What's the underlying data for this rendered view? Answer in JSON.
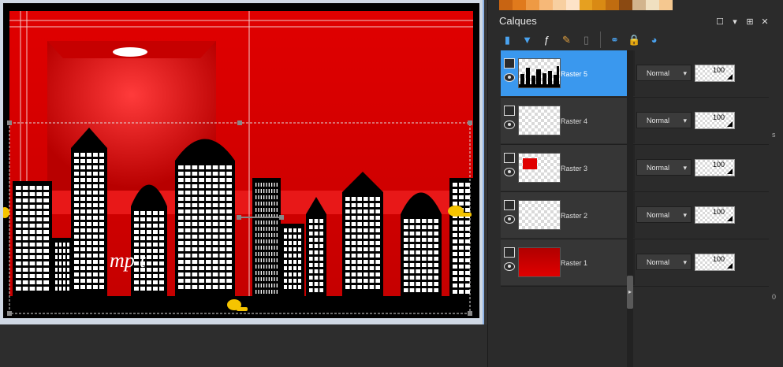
{
  "panel": {
    "title": "Calques",
    "title_buttons": [
      "☐",
      "▾",
      "⊞",
      "✕"
    ],
    "palette_colors": [
      "#c86412",
      "#e07a1c",
      "#ee9a44",
      "#f6b878",
      "#f7cfa0",
      "#fde3c8",
      "#e6a020",
      "#d98a14",
      "#c06c10",
      "#8b4a12",
      "#d2b48c",
      "#f0e0c0",
      "#f5c890"
    ],
    "toolbar_icons": [
      {
        "name": "new-raster-layer-icon",
        "glyph": "▮",
        "color": "#4aa3f0"
      },
      {
        "name": "new-vector-layer-icon",
        "glyph": "▼",
        "color": "#4aa3f0"
      },
      {
        "name": "fx-effects-icon",
        "glyph": "ƒ",
        "color": "#ffffff"
      },
      {
        "name": "paint-brush-icon",
        "glyph": "✎",
        "color": "#e0a040"
      },
      {
        "name": "mask-icon",
        "glyph": "▯",
        "color": "#777777"
      },
      {
        "name": "link-icon",
        "glyph": "⚭",
        "color": "#4aa3f0"
      },
      {
        "name": "lock-icon",
        "glyph": "🔒",
        "color": "#e0b020"
      },
      {
        "name": "palette-icon",
        "glyph": "◕",
        "color": "#4aa3f0"
      }
    ],
    "layers": [
      {
        "name": "Raster 5",
        "blend": "Normal",
        "opacity": "100",
        "selected": true,
        "thumb": "city"
      },
      {
        "name": "Raster 4",
        "blend": "Normal",
        "opacity": "100",
        "selected": false,
        "thumb": "empty"
      },
      {
        "name": "Raster 3",
        "blend": "Normal",
        "opacity": "100",
        "selected": false,
        "thumb": "redsmall"
      },
      {
        "name": "Raster 2",
        "blend": "Normal",
        "opacity": "100",
        "selected": false,
        "thumb": "empty"
      },
      {
        "name": "Raster 1",
        "blend": "Normal",
        "opacity": "100",
        "selected": false,
        "thumb": "red"
      }
    ],
    "edge_text_1": "s",
    "edge_text_2": "0"
  },
  "colors": {
    "selected_row": "#3a98ee",
    "canvas_red": "#d40000",
    "building_black": "#000000",
    "building_white": "#ffffff"
  },
  "canvas": {
    "signature_text": "mp  t"
  }
}
